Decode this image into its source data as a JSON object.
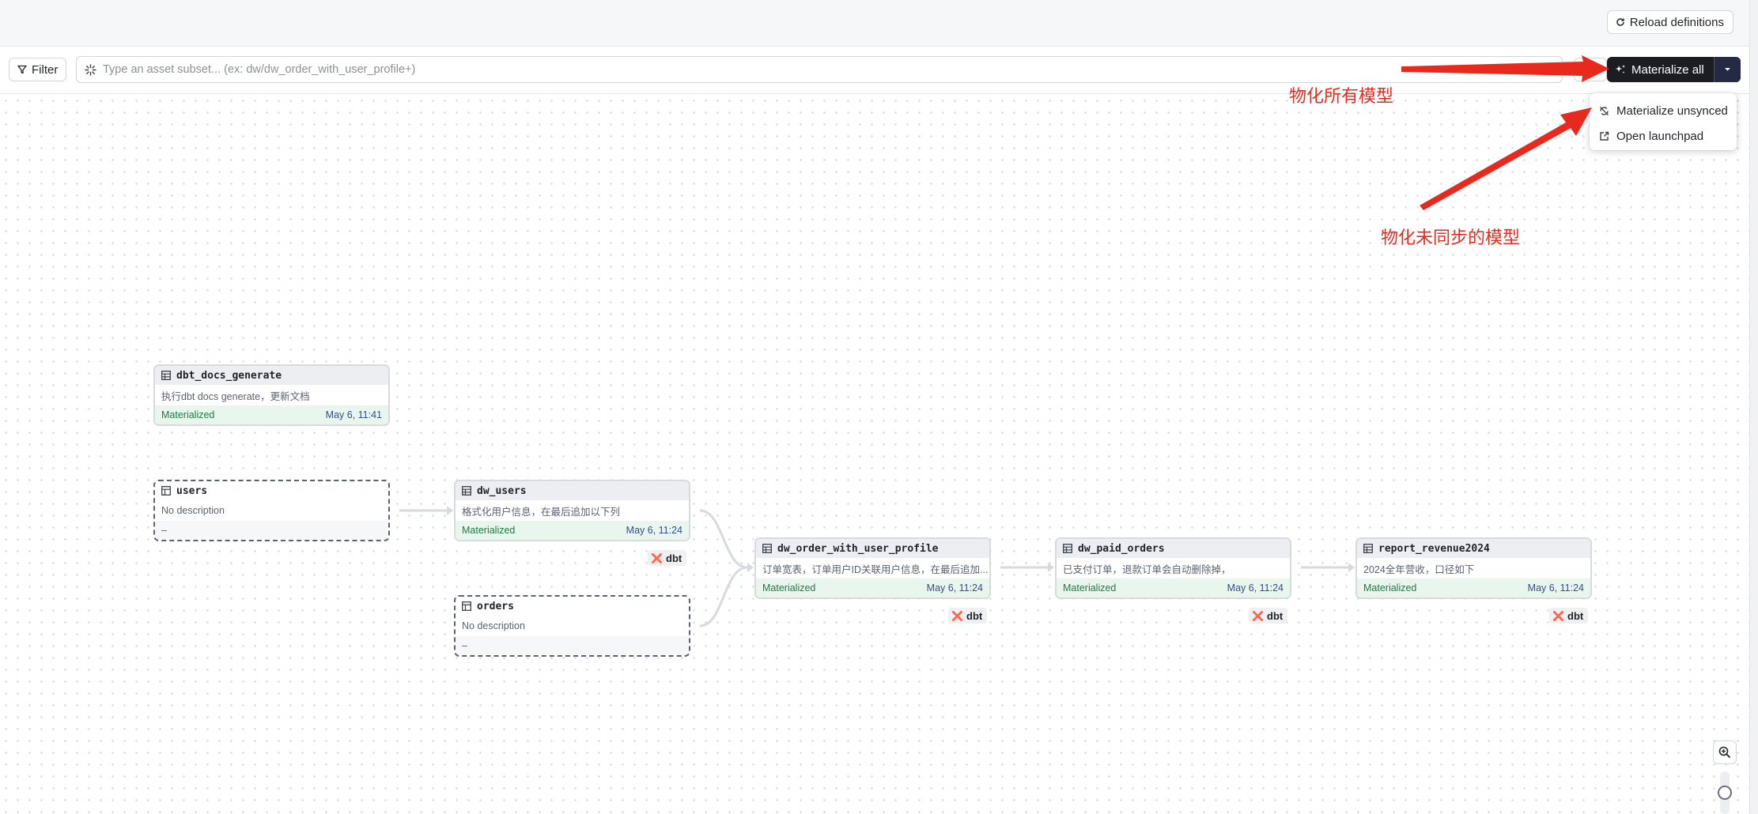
{
  "header": {
    "reload_label": "Reload definitions"
  },
  "toolbar": {
    "filter_label": "Filter",
    "search_placeholder": "Type an asset subset... (ex: dw/dw_order_with_user_profile+)",
    "search_value": "",
    "materialize_all_label": "Materialize all"
  },
  "dropdown": {
    "items": [
      {
        "label": "Materialize unsynced",
        "icon": "sync-icon"
      },
      {
        "label": "Open launchpad",
        "icon": "external-link-icon"
      }
    ]
  },
  "annotations": {
    "materialize_all_note": "物化所有模型",
    "materialize_unsynced_note": "物化未同步的模型",
    "arrow_color": "#e8291e"
  },
  "nodes": {
    "dbt_docs_generate": {
      "name": "dbt_docs_generate",
      "description": "执行dbt docs generate，更新文档",
      "status": "Materialized",
      "date": "May 6, 11:41"
    },
    "users": {
      "name": "users",
      "description": "No description",
      "status": "–"
    },
    "dw_users": {
      "name": "dw_users",
      "description": "格式化用户信息，在最后追加以下列",
      "status": "Materialized",
      "date": "May 6, 11:24",
      "tag": "dbt"
    },
    "orders": {
      "name": "orders",
      "description": "No description",
      "status": "–"
    },
    "dw_order_with_user_profile": {
      "name": "dw_order_with_user_profile",
      "description": "订单宽表，订单用户ID关联用户信息，在最后追加...",
      "status": "Materialized",
      "date": "May 6, 11:24",
      "tag": "dbt"
    },
    "dw_paid_orders": {
      "name": "dw_paid_orders",
      "description": "已支付订单，退款订单会自动删除掉，",
      "status": "Materialized",
      "date": "May 6, 11:24",
      "tag": "dbt"
    },
    "report_revenue2024": {
      "name": "report_revenue2024",
      "description": "2024全年营收，口径如下",
      "status": "Materialized",
      "date": "May 6, 11:24",
      "tag": "dbt"
    }
  },
  "colors": {
    "materialized_bg": "#e8f6ee",
    "materialized_text": "#1e7a45",
    "dbt_brand": "#ff694b",
    "primary_button": "#1b1d22"
  }
}
